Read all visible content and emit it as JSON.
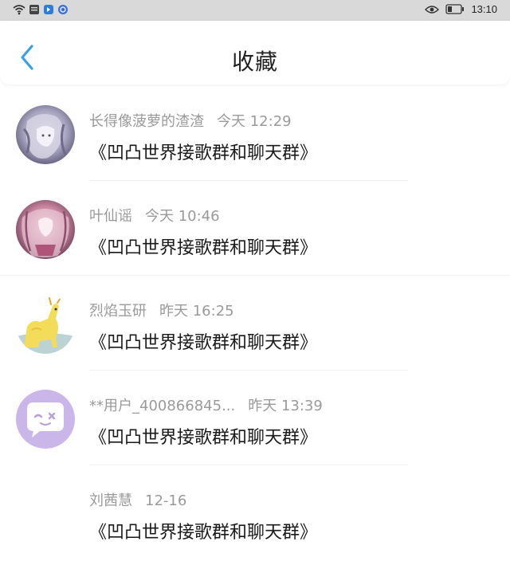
{
  "status_bar": {
    "time": "13:10",
    "icons": [
      "wifi-icon",
      "notification-icon",
      "app-icon",
      "app-icon",
      "eye-icon",
      "battery-icon"
    ]
  },
  "header": {
    "title": "收藏",
    "back_icon": "chevron-left-icon",
    "accent": "#3aa0e8"
  },
  "items": [
    {
      "author": "长得像菠萝的渣渣",
      "time": "今天 12:29",
      "content": "《凹凸世界接歌群和聊天群》",
      "avatar": "anime-girl-gray"
    },
    {
      "author": "叶仙谣",
      "time": "今天 10:46",
      "content": "《凹凸世界接歌群和聊天群》",
      "avatar": "anime-girl-pink"
    },
    {
      "author": "烈焰玉研",
      "time": "昨天 16:25",
      "content": "《凹凸世界接歌群和聊天群》",
      "avatar": "yellow-alpaca"
    },
    {
      "author": "**用户_400866845...",
      "time": "昨天 13:39",
      "content": "《凹凸世界接歌群和聊天群》",
      "avatar": "purple-chat-default"
    },
    {
      "author": "刘茜慧",
      "time": "12-16",
      "content": "《凹凸世界接歌群和聊天群》",
      "avatar": "blank"
    }
  ]
}
